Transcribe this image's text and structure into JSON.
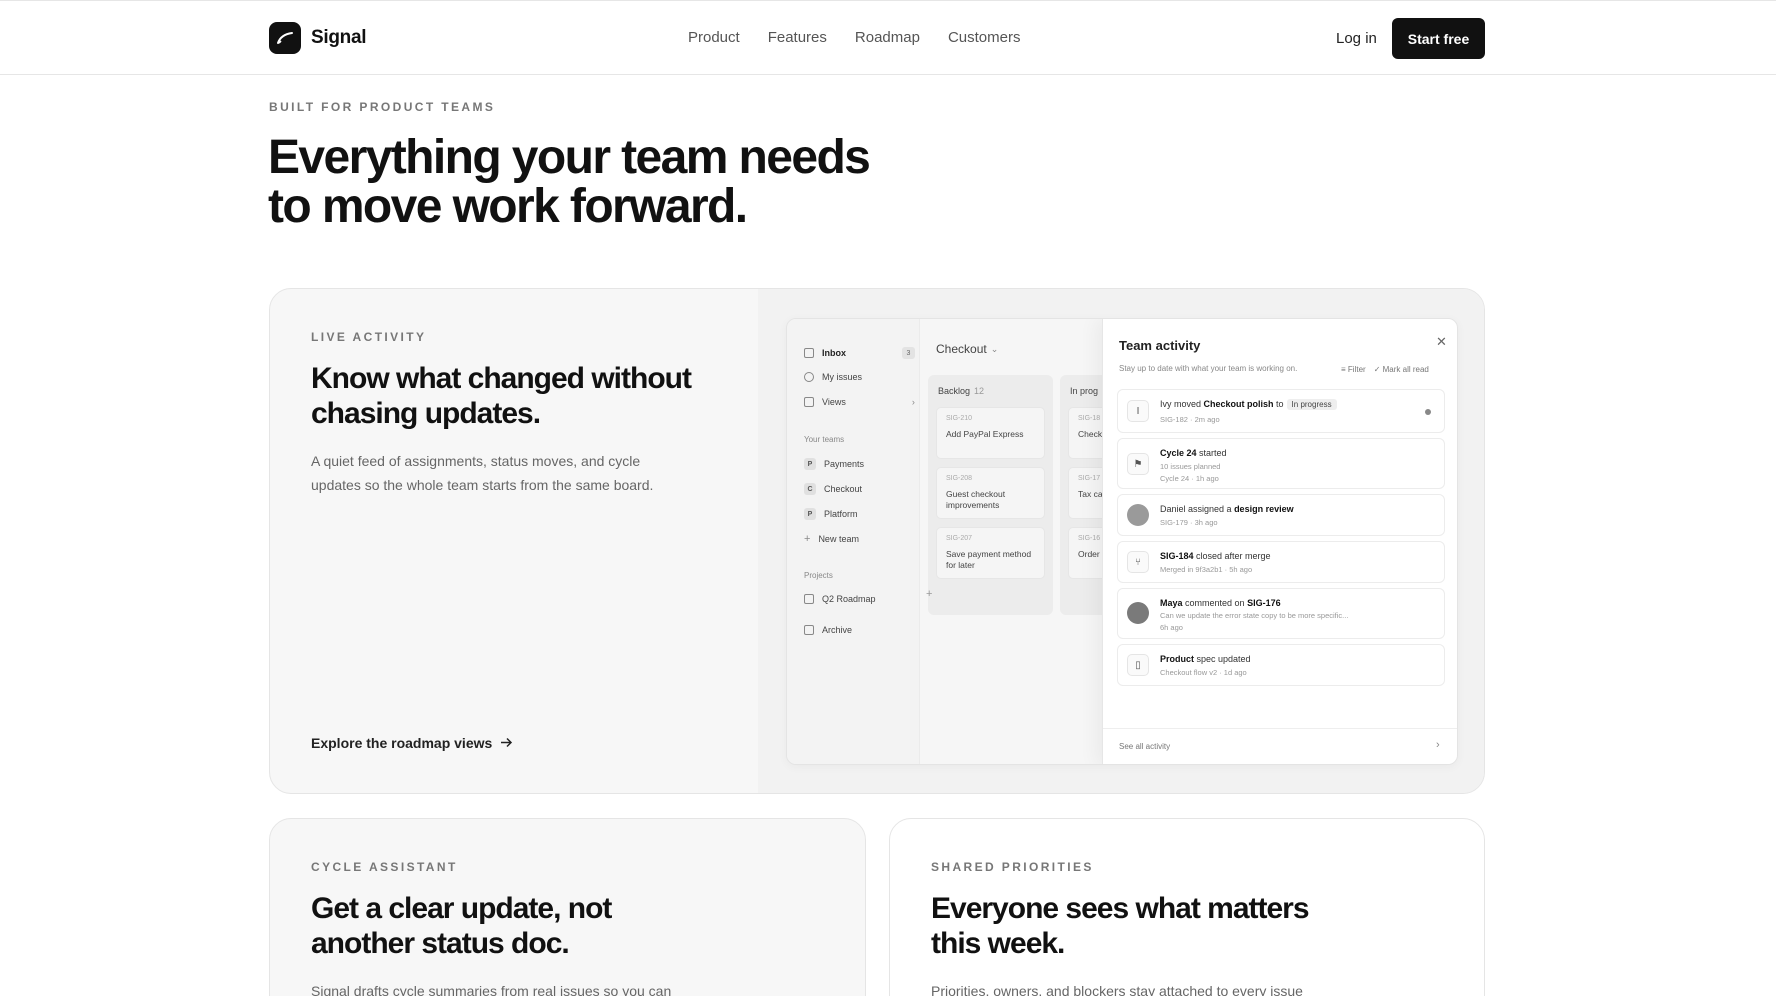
{
  "header": {
    "brand": "Signal",
    "nav": [
      "Product",
      "Features",
      "Roadmap",
      "Customers"
    ],
    "login": "Log in",
    "cta": "Start free"
  },
  "hero": {
    "eyebrow": "BUILT FOR PRODUCT TEAMS",
    "title_line1": "Everything your team needs",
    "title_line2": "to move work forward."
  },
  "live": {
    "eyebrow": "LIVE ACTIVITY",
    "title_line1": "Know what changed without",
    "title_line2": "chasing updates.",
    "desc_line1": "A quiet feed of assignments, status moves, and cycle",
    "desc_line2": "updates so the whole team starts from the same board.",
    "link": "Explore the roadmap views"
  },
  "mock": {
    "sidebar": {
      "inbox": "Inbox",
      "inbox_count": "3",
      "my_issues": "My issues",
      "views": "Views",
      "teams_label": "Your teams",
      "teams": [
        {
          "chip": "P",
          "name": "Payments"
        },
        {
          "chip": "C",
          "name": "Checkout"
        },
        {
          "chip": "P",
          "name": "Platform"
        }
      ],
      "new_team": "New team",
      "projects_label": "Projects",
      "project": "Q2 Roadmap",
      "archive": "Archive"
    },
    "board": {
      "title": "Checkout",
      "columns": [
        {
          "name": "Backlog",
          "count": "12",
          "issues": [
            {
              "id": "SIG-210",
              "title": "Add PayPal Express"
            },
            {
              "id": "SIG-208",
              "title": "Guest checkout improvements"
            },
            {
              "id": "SIG-207",
              "title": "Save payment method for later"
            }
          ]
        },
        {
          "name": "In prog",
          "issues": [
            {
              "id": "SIG-18",
              "title": "Check"
            },
            {
              "id": "SIG-17",
              "title": "Tax cal"
            },
            {
              "id": "SIG-16",
              "title": "Order s"
            }
          ]
        }
      ]
    },
    "activity": {
      "title": "Team activity",
      "subtitle": "Stay up to date with what your team is working on.",
      "filter": "Filter",
      "mark_read": "Mark all read",
      "items": [
        {
          "pre": "Ivy moved ",
          "b1": "Checkout polish",
          "mid": " to",
          "pill": "In progress",
          "meta": "SIG-182 · 2m ago",
          "icon": "I"
        },
        {
          "b1": "Cycle 24",
          "mid": " started",
          "meta2": "10 issues planned",
          "meta": "Cycle 24 · 1h ago"
        },
        {
          "pre": "Daniel assigned a ",
          "b1": "design review",
          "meta": "SIG-179 · 3h ago"
        },
        {
          "b1": "SIG-184",
          "mid": " closed after merge",
          "meta": "Merged in 9f3a2b1 · 5h ago"
        },
        {
          "b1": "Maya",
          "mid": " commented on ",
          "b2": "SIG-176",
          "meta2": "Can we update the error state copy to be more specific...",
          "meta": "6h ago"
        },
        {
          "b1": "Product",
          "mid": " spec updated",
          "meta": "Checkout flow v2 · 1d ago"
        }
      ],
      "see_all": "See all activity"
    }
  },
  "cycle": {
    "eyebrow": "CYCLE ASSISTANT",
    "title_line1": "Get a clear update, not",
    "title_line2": "another status doc.",
    "desc": "Signal drafts cycle summaries from real issues so you can"
  },
  "priorities": {
    "eyebrow": "SHARED PRIORITIES",
    "title_line1": "Everyone sees what matters",
    "title_line2": "this week.",
    "desc": "Priorities, owners, and blockers stay attached to every issue"
  }
}
